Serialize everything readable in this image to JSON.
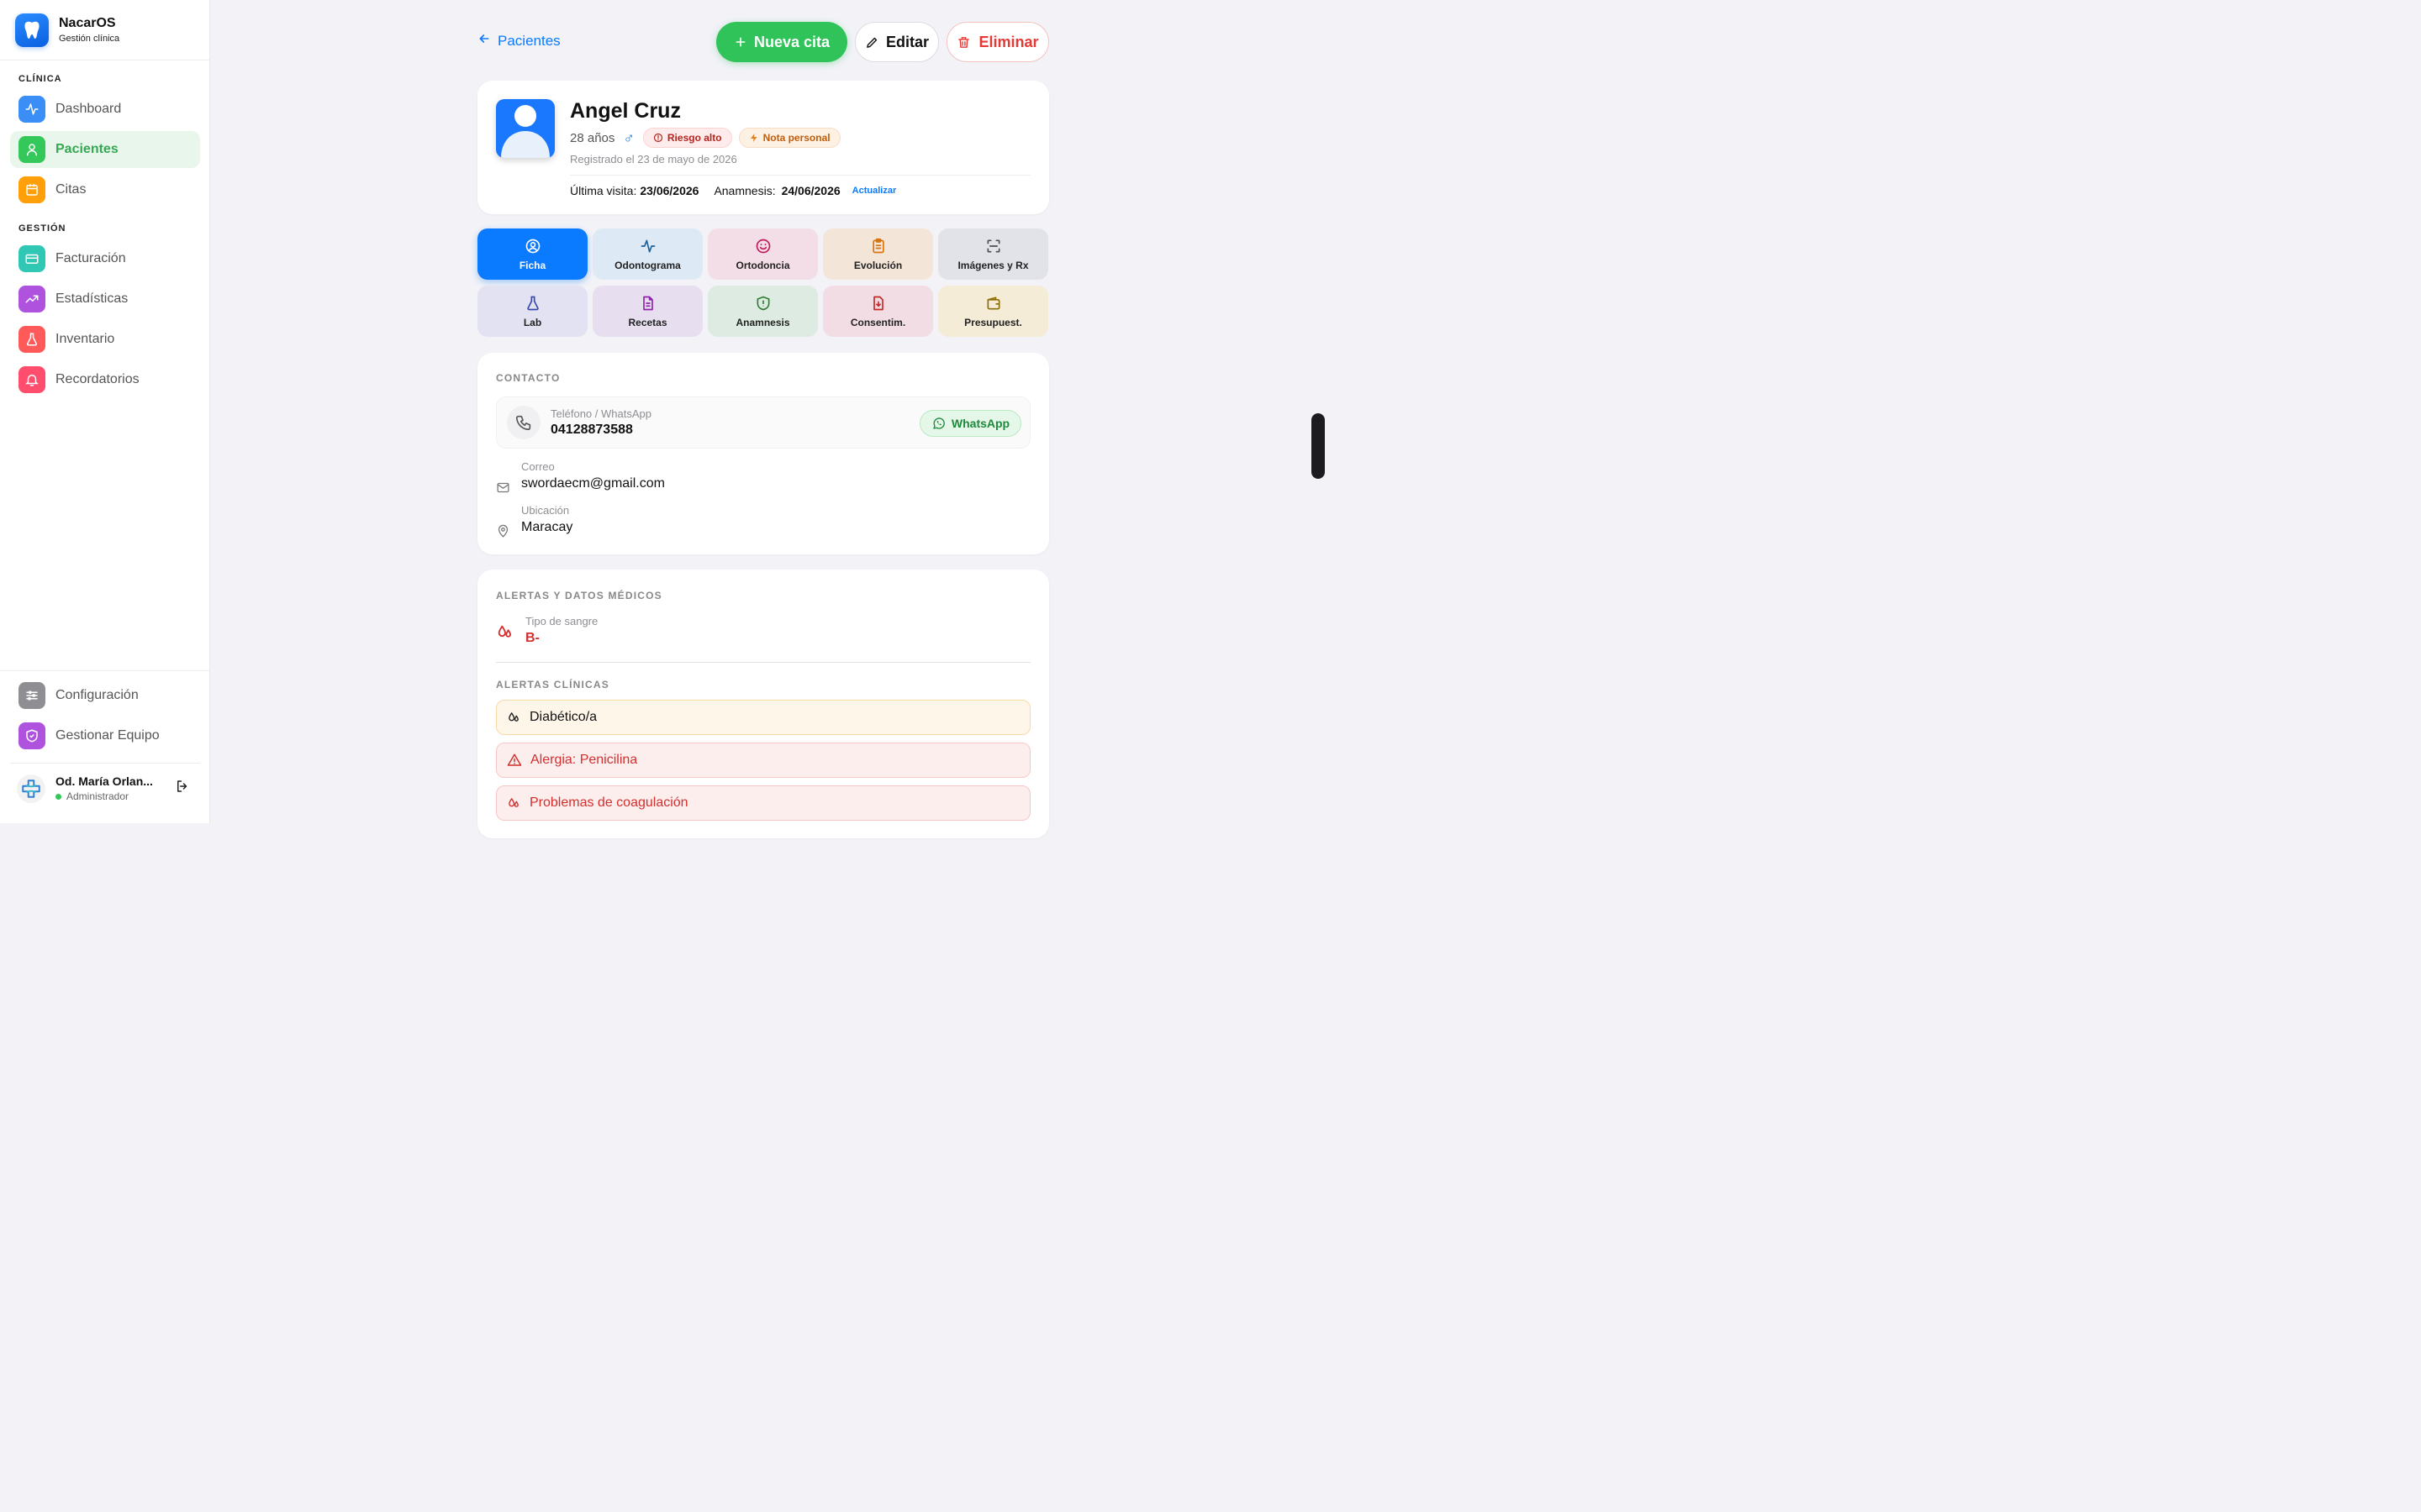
{
  "brand": {
    "name": "NacarOS",
    "subtitle": "Gestión clínica"
  },
  "sidebar": {
    "section_clinic": "CLÍNICA",
    "section_management": "GESTIÓN",
    "items": [
      {
        "label": "Dashboard",
        "icon": "activity-icon",
        "color": "#3b8ef5"
      },
      {
        "label": "Pacientes",
        "icon": "user-icon",
        "color": "#34c759",
        "active": true
      },
      {
        "label": "Citas",
        "icon": "calendar-icon",
        "color": "#ff9f0a"
      },
      {
        "label": "Facturación",
        "icon": "credit-card-icon",
        "color": "#30c7b5"
      },
      {
        "label": "Estadísticas",
        "icon": "trend-icon",
        "color": "#af52de"
      },
      {
        "label": "Inventario",
        "icon": "flask-icon",
        "color": "#ff5a5a"
      },
      {
        "label": "Recordatorios",
        "icon": "bell-icon",
        "color": "#ff4d6d"
      }
    ],
    "bottom_items": [
      {
        "label": "Configuración",
        "icon": "sliders-icon",
        "color": "#8e8e93"
      },
      {
        "label": "Gestionar Equipo",
        "icon": "shield-icon",
        "color": "#af52de"
      }
    ],
    "user": {
      "name": "Od. María Orlan...",
      "role": "Administrador"
    }
  },
  "topbar": {
    "back_label": "Pacientes",
    "new_label": "Nueva cita",
    "edit_label": "Editar",
    "delete_label": "Eliminar"
  },
  "patient": {
    "name": "Angel Cruz",
    "age": "28 años",
    "gender_symbol": "♂",
    "badge_risk": "Riesgo alto",
    "badge_note": "Nota personal",
    "registered": "Registrado el 23 de mayo de 2026",
    "last_visit_label": "Última visita:",
    "last_visit": "23/06/2026",
    "anamnesis_label": "Anamnesis:",
    "anamnesis": "24/06/2026",
    "update_label": "Actualizar"
  },
  "tabs": [
    {
      "label": "Ficha",
      "icon": "user-circle-icon",
      "bg": "#0a7aff",
      "fg": "#ffffff",
      "active": true
    },
    {
      "label": "Odontograma",
      "icon": "activity-icon",
      "bg": "#dde9f5",
      "fg": "#1f5f99"
    },
    {
      "label": "Ortodoncia",
      "icon": "smile-icon",
      "bg": "#f3dde6",
      "fg": "#c2185b"
    },
    {
      "label": "Evolución",
      "icon": "clipboard-icon",
      "bg": "#f3e6d8",
      "fg": "#d9730d"
    },
    {
      "label": "Imágenes y Rx",
      "icon": "scan-icon",
      "bg": "#e1e3e8",
      "fg": "#4a4f57"
    },
    {
      "label": "Lab",
      "icon": "flask-icon",
      "bg": "#e3e2f2",
      "fg": "#3949ab"
    },
    {
      "label": "Recetas",
      "icon": "document-icon",
      "bg": "#e7dff0",
      "fg": "#8e24aa"
    },
    {
      "label": "Anamnesis",
      "icon": "shield-icon",
      "bg": "#deebe3",
      "fg": "#2e7d32"
    },
    {
      "label": "Consentim.",
      "icon": "file-download-icon",
      "bg": "#f3dde4",
      "fg": "#c62828"
    },
    {
      "label": "Presupuest.",
      "icon": "wallet-icon",
      "bg": "#f4ecd6",
      "fg": "#8d6e00"
    }
  ],
  "contact": {
    "title": "CONTACTO",
    "phone_label": "Teléfono / WhatsApp",
    "phone": "04128873588",
    "whatsapp_label": "WhatsApp",
    "email_label": "Correo",
    "email": "swordaecm@gmail.com",
    "location_label": "Ubicación",
    "location": "Maracay"
  },
  "medical": {
    "title": "ALERTAS Y DATOS MÉDICOS",
    "blood_label": "Tipo de sangre",
    "blood": "B-",
    "alerts_title": "ALERTAS CLÍNICAS",
    "alerts": [
      {
        "label": "Diabético/a",
        "level": "warning"
      },
      {
        "label": "Alergia: Penicilina",
        "level": "danger"
      },
      {
        "label": "Problemas de coagulación",
        "level": "danger"
      }
    ]
  }
}
